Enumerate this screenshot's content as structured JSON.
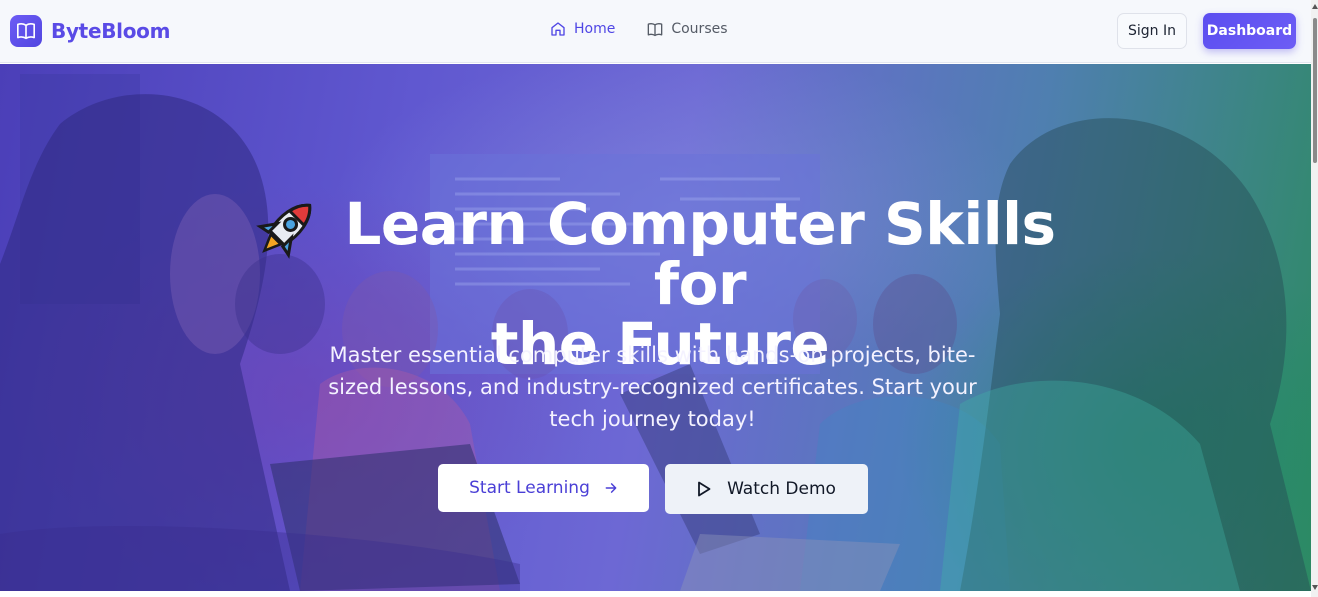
{
  "header": {
    "brand": "ByteBloom",
    "brand_icon": "open-book-icon",
    "nav": [
      {
        "label": "Home",
        "icon": "home-icon",
        "active": true
      },
      {
        "label": "Courses",
        "icon": "book-icon",
        "active": false
      }
    ],
    "sign_in_label": "Sign In",
    "dashboard_label": "Dashboard"
  },
  "hero": {
    "title_line1": "Learn Computer Skills for",
    "title_line2": "the Future",
    "title_icon": "rocket-emoji",
    "subtitle": "Master essential computer skills with hands-on projects, bite-sized lessons, and industry-recognized certificates. Start your tech journey today!",
    "primary_cta": "Start Learning",
    "primary_cta_icon": "arrow-right-icon",
    "secondary_cta": "Watch Demo",
    "secondary_cta_icon": "play-icon",
    "background_image": "classroom-people-laptops-photo"
  },
  "colors": {
    "brand": "#5a4be6",
    "accent": "#4f46e5",
    "hero_left": "#4b3fb8",
    "hero_right": "#2e8a64"
  }
}
